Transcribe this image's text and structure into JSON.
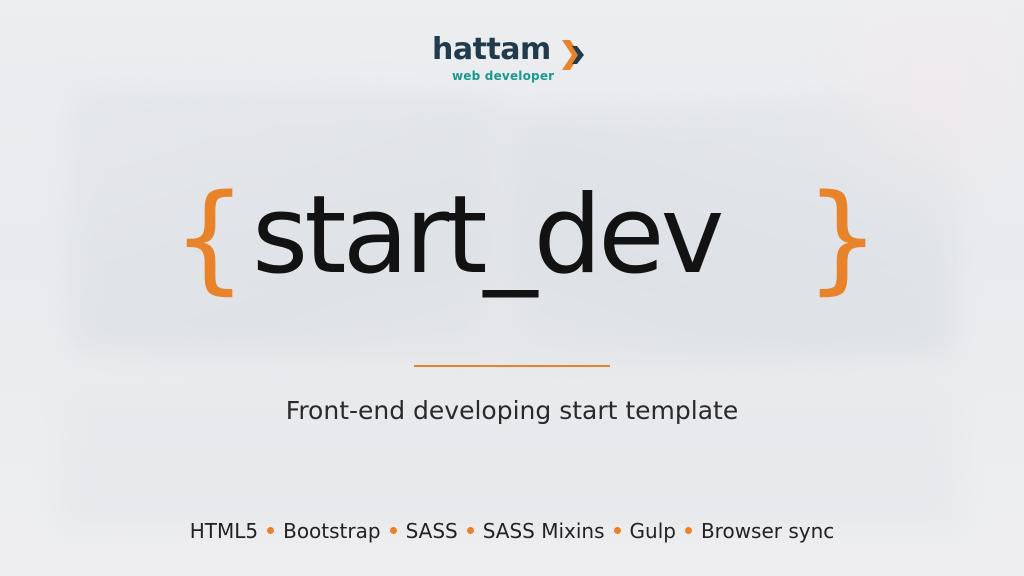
{
  "logo": {
    "word": "hattam",
    "tagline": "web developer",
    "icon": "double-chevron-right-icon",
    "colors": {
      "word": "#1f3b4d",
      "tagline": "#1a9a8e",
      "arrow_primary": "#e8832a",
      "arrow_secondary": "#1f3b4d"
    }
  },
  "title": {
    "open_brace": "{",
    "text": "start_dev",
    "close_brace": "}"
  },
  "subtitle": "Front-end developing start template",
  "technologies": [
    "HTML5",
    "Bootstrap",
    "SASS",
    "SASS Mixins",
    "Gulp",
    "Browser sync"
  ],
  "colors": {
    "accent": "#e8832a",
    "text": "#121212"
  }
}
